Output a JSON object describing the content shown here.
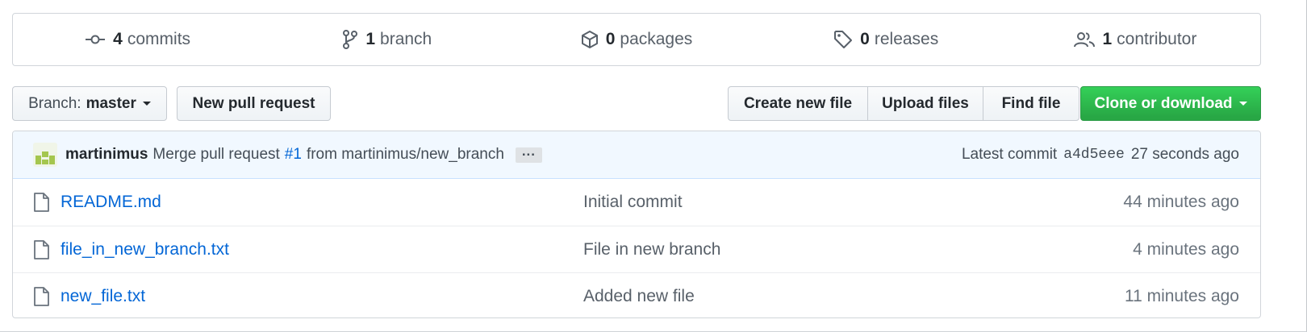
{
  "summary": {
    "commits": {
      "count": "4",
      "label": "commits"
    },
    "branches": {
      "count": "1",
      "label": "branch"
    },
    "packages": {
      "count": "0",
      "label": "packages"
    },
    "releases": {
      "count": "0",
      "label": "releases"
    },
    "contributors": {
      "count": "1",
      "label": "contributor"
    }
  },
  "toolbar": {
    "branch_prefix": "Branch:",
    "branch_name": "master",
    "new_pr": "New pull request",
    "create_file": "Create new file",
    "upload_files": "Upload files",
    "find_file": "Find file",
    "clone": "Clone or download"
  },
  "latest_commit": {
    "author": "martinimus",
    "message_prefix": "Merge pull request",
    "pr_link": "#1",
    "message_suffix": "from martinimus/new_branch",
    "label": "Latest commit",
    "sha": "a4d5eee",
    "time": "27 seconds ago"
  },
  "files": [
    {
      "name": "README.md",
      "message": "Initial commit",
      "age": "44 minutes ago"
    },
    {
      "name": "file_in_new_branch.txt",
      "message": "File in new branch",
      "age": "4 minutes ago"
    },
    {
      "name": "new_file.txt",
      "message": "Added new file",
      "age": "11 minutes ago"
    }
  ],
  "colors": {
    "link": "#0366d6",
    "green_button": "#28a745",
    "commit_bar": "#f1f8ff"
  }
}
